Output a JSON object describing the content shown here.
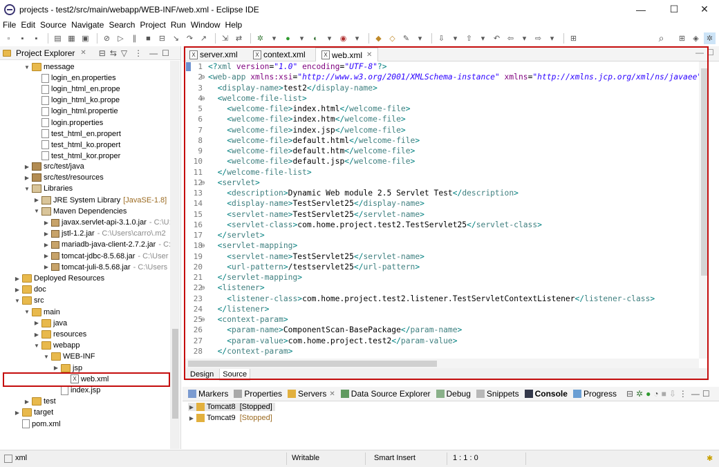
{
  "window": {
    "title": "projects - test2/src/main/webapp/WEB-INF/web.xml - Eclipse IDE",
    "minimize": "—",
    "maximize": "☐",
    "close": "✕"
  },
  "menu": [
    "File",
    "Edit",
    "Source",
    "Navigate",
    "Search",
    "Project",
    "Run",
    "Window",
    "Help"
  ],
  "explorer": {
    "title": "Project Explorer",
    "tree": [
      {
        "label": "message",
        "icon": "folder",
        "twist": "open",
        "level": 0
      },
      {
        "label": "login_en.properties",
        "icon": "file",
        "twist": "",
        "level": 1
      },
      {
        "label": "login_html_en.prope",
        "icon": "file",
        "twist": "",
        "level": 1
      },
      {
        "label": "login_html_ko.prope",
        "icon": "file",
        "twist": "",
        "level": 1
      },
      {
        "label": "login_html.propertie",
        "icon": "file",
        "twist": "",
        "level": 1
      },
      {
        "label": "login.properties",
        "icon": "file",
        "twist": "",
        "level": 1
      },
      {
        "label": "test_html_en.propert",
        "icon": "file",
        "twist": "",
        "level": 1
      },
      {
        "label": "test_html_ko.propert",
        "icon": "file",
        "twist": "",
        "level": 1
      },
      {
        "label": "test_html_kor.proper",
        "icon": "file",
        "twist": "",
        "level": 1
      }
    ],
    "tree2": [
      {
        "label": "src/test/java",
        "icon": "pkg",
        "twist": "closed",
        "level": 0
      },
      {
        "label": "src/test/resources",
        "icon": "pkg",
        "twist": "closed",
        "level": 0
      },
      {
        "label": "Libraries",
        "icon": "lib",
        "twist": "open",
        "level": 0
      },
      {
        "label": "JRE System Library",
        "extra": "[JavaSE-1.8]",
        "icon": "lib",
        "twist": "closed",
        "level": 1
      },
      {
        "label": "Maven Dependencies",
        "icon": "lib",
        "twist": "open",
        "level": 1
      },
      {
        "label": "javax.servlet-api-3.1.0.jar",
        "extra": "- C:\\U:",
        "icon": "jar",
        "twist": "closed",
        "level": 2
      },
      {
        "label": "jstl-1.2.jar",
        "extra": "- C:\\Users\\carro\\.m2",
        "icon": "jar",
        "twist": "closed",
        "level": 2
      },
      {
        "label": "mariadb-java-client-2.7.2.jar",
        "extra": "- C:",
        "icon": "jar",
        "twist": "closed",
        "level": 2
      },
      {
        "label": "tomcat-jdbc-8.5.68.jar",
        "extra": "- C:\\User",
        "icon": "jar",
        "twist": "closed",
        "level": 2
      },
      {
        "label": "tomcat-juli-8.5.68.jar",
        "extra": "- C:\\Users",
        "icon": "jar",
        "twist": "closed",
        "level": 2
      },
      {
        "label": "Deployed Resources",
        "icon": "folder",
        "twist": "closed",
        "level": -1
      },
      {
        "label": "doc",
        "icon": "folder",
        "twist": "closed",
        "level": -1
      },
      {
        "label": "src",
        "icon": "folder",
        "twist": "open",
        "level": -1
      },
      {
        "label": "main",
        "icon": "folder",
        "twist": "open",
        "level": 0
      },
      {
        "label": "java",
        "icon": "folder",
        "twist": "closed",
        "level": 1
      },
      {
        "label": "resources",
        "icon": "folder",
        "twist": "closed",
        "level": 1
      },
      {
        "label": "webapp",
        "icon": "folder",
        "twist": "open",
        "level": 1
      },
      {
        "label": "WEB-INF",
        "icon": "folder",
        "twist": "open",
        "level": 2
      },
      {
        "label": "jsp",
        "icon": "folder",
        "twist": "closed",
        "level": 3
      },
      {
        "label": "web.xml",
        "icon": "xml",
        "twist": "",
        "level": 4
      },
      {
        "label": "index.jsp",
        "icon": "file",
        "twist": "",
        "level": 3
      },
      {
        "label": "test",
        "icon": "folder",
        "twist": "closed",
        "level": 0
      },
      {
        "label": "target",
        "icon": "folder",
        "twist": "closed",
        "level": -1
      },
      {
        "label": "pom.xml",
        "icon": "file",
        "twist": "",
        "level": -1
      }
    ]
  },
  "editor": {
    "tabs": [
      "server.xml",
      "context.xml",
      "web.xml"
    ],
    "active_tab": "web.xml",
    "bottom_tabs": [
      "Design",
      "Source"
    ],
    "lines": [
      {
        "n": "1",
        "fold": false,
        "html": "<span class=\"p\">&lt;?</span><span class=\"t\">xml</span> <span class=\"a\">version</span>=<span class=\"v\">\"1.0\"</span> <span class=\"a\">encoding</span>=<span class=\"v\">\"UTF-8\"</span><span class=\"p\">?&gt;</span>"
      },
      {
        "n": "2",
        "fold": true,
        "html": "<span class=\"p\">&lt;</span><span class=\"t\">web-app</span> <span class=\"a\">xmlns:xsi</span>=<span class=\"v\">\"http://www.w3.org/2001/XMLSchema-instance\"</span> <span class=\"a\">xmlns</span>=<span class=\"v\">\"http://xmlns.jcp.org/xml/ns/javaee\"</span>"
      },
      {
        "n": "3",
        "fold": false,
        "html": "  <span class=\"p\">&lt;</span><span class=\"t\">display-name</span><span class=\"p\">&gt;</span>test2<span class=\"p\">&lt;/</span><span class=\"t\">display-name</span><span class=\"p\">&gt;</span>"
      },
      {
        "n": "4",
        "fold": true,
        "html": "  <span class=\"p\">&lt;</span><span class=\"t\">welcome-file-list</span><span class=\"p\">&gt;</span>"
      },
      {
        "n": "5",
        "fold": false,
        "html": "    <span class=\"p\">&lt;</span><span class=\"t\">welcome-file</span><span class=\"p\">&gt;</span>index.html<span class=\"p\">&lt;/</span><span class=\"t\">welcome-file</span><span class=\"p\">&gt;</span>"
      },
      {
        "n": "6",
        "fold": false,
        "html": "    <span class=\"p\">&lt;</span><span class=\"t\">welcome-file</span><span class=\"p\">&gt;</span>index.htm<span class=\"p\">&lt;/</span><span class=\"t\">welcome-file</span><span class=\"p\">&gt;</span>"
      },
      {
        "n": "7",
        "fold": false,
        "html": "    <span class=\"p\">&lt;</span><span class=\"t\">welcome-file</span><span class=\"p\">&gt;</span>index.jsp<span class=\"p\">&lt;/</span><span class=\"t\">welcome-file</span><span class=\"p\">&gt;</span>"
      },
      {
        "n": "8",
        "fold": false,
        "html": "    <span class=\"p\">&lt;</span><span class=\"t\">welcome-file</span><span class=\"p\">&gt;</span>default.html<span class=\"p\">&lt;/</span><span class=\"t\">welcome-file</span><span class=\"p\">&gt;</span>"
      },
      {
        "n": "9",
        "fold": false,
        "html": "    <span class=\"p\">&lt;</span><span class=\"t\">welcome-file</span><span class=\"p\">&gt;</span>default.htm<span class=\"p\">&lt;/</span><span class=\"t\">welcome-file</span><span class=\"p\">&gt;</span>"
      },
      {
        "n": "10",
        "fold": false,
        "html": "    <span class=\"p\">&lt;</span><span class=\"t\">welcome-file</span><span class=\"p\">&gt;</span>default.jsp<span class=\"p\">&lt;/</span><span class=\"t\">welcome-file</span><span class=\"p\">&gt;</span>"
      },
      {
        "n": "11",
        "fold": false,
        "html": "  <span class=\"p\">&lt;/</span><span class=\"t\">welcome-file-list</span><span class=\"p\">&gt;</span>"
      },
      {
        "n": "12",
        "fold": true,
        "html": "  <span class=\"p\">&lt;</span><span class=\"t\">servlet</span><span class=\"p\">&gt;</span>"
      },
      {
        "n": "13",
        "fold": false,
        "html": "    <span class=\"p\">&lt;</span><span class=\"t\">description</span><span class=\"p\">&gt;</span>Dynamic Web module 2.5 Servlet Test<span class=\"p\">&lt;/</span><span class=\"t\">description</span><span class=\"p\">&gt;</span>"
      },
      {
        "n": "14",
        "fold": false,
        "html": "    <span class=\"p\">&lt;</span><span class=\"t\">display-name</span><span class=\"p\">&gt;</span>TestServlet25<span class=\"p\">&lt;/</span><span class=\"t\">display-name</span><span class=\"p\">&gt;</span>"
      },
      {
        "n": "15",
        "fold": false,
        "html": "    <span class=\"p\">&lt;</span><span class=\"t\">servlet-name</span><span class=\"p\">&gt;</span>TestServlet25<span class=\"p\">&lt;/</span><span class=\"t\">servlet-name</span><span class=\"p\">&gt;</span>"
      },
      {
        "n": "16",
        "fold": false,
        "html": "    <span class=\"p\">&lt;</span><span class=\"t\">servlet-class</span><span class=\"p\">&gt;</span>com.home.project.test2.TestServlet25<span class=\"p\">&lt;/</span><span class=\"t\">servlet-class</span><span class=\"p\">&gt;</span>"
      },
      {
        "n": "17",
        "fold": false,
        "html": "  <span class=\"p\">&lt;/</span><span class=\"t\">servlet</span><span class=\"p\">&gt;</span>"
      },
      {
        "n": "18",
        "fold": true,
        "html": "  <span class=\"p\">&lt;</span><span class=\"t\">servlet-mapping</span><span class=\"p\">&gt;</span>"
      },
      {
        "n": "19",
        "fold": false,
        "html": "    <span class=\"p\">&lt;</span><span class=\"t\">servlet-name</span><span class=\"p\">&gt;</span>TestServlet25<span class=\"p\">&lt;/</span><span class=\"t\">servlet-name</span><span class=\"p\">&gt;</span>"
      },
      {
        "n": "20",
        "fold": false,
        "html": "    <span class=\"p\">&lt;</span><span class=\"t\">url-pattern</span><span class=\"p\">&gt;</span>/testservlet25<span class=\"p\">&lt;/</span><span class=\"t\">url-pattern</span><span class=\"p\">&gt;</span>"
      },
      {
        "n": "21",
        "fold": false,
        "html": "  <span class=\"p\">&lt;/</span><span class=\"t\">servlet-mapping</span><span class=\"p\">&gt;</span>"
      },
      {
        "n": "22",
        "fold": true,
        "html": "  <span class=\"p\">&lt;</span><span class=\"t\">listener</span><span class=\"p\">&gt;</span>"
      },
      {
        "n": "23",
        "fold": false,
        "html": "    <span class=\"p\">&lt;</span><span class=\"t\">listener-class</span><span class=\"p\">&gt;</span>com.home.project.test2.listener.TestServletContextListener<span class=\"p\">&lt;/</span><span class=\"t\">listener-class</span><span class=\"p\">&gt;</span>"
      },
      {
        "n": "24",
        "fold": false,
        "html": "  <span class=\"p\">&lt;/</span><span class=\"t\">listener</span><span class=\"p\">&gt;</span>"
      },
      {
        "n": "25",
        "fold": true,
        "html": "  <span class=\"p\">&lt;</span><span class=\"t\">context-param</span><span class=\"p\">&gt;</span>"
      },
      {
        "n": "26",
        "fold": false,
        "html": "    <span class=\"p\">&lt;</span><span class=\"t\">param-name</span><span class=\"p\">&gt;</span>ComponentScan-BasePackage<span class=\"p\">&lt;/</span><span class=\"t\">param-name</span><span class=\"p\">&gt;</span>"
      },
      {
        "n": "27",
        "fold": false,
        "html": "    <span class=\"p\">&lt;</span><span class=\"t\">param-value</span><span class=\"p\">&gt;</span>com.home.project.test2<span class=\"p\">&lt;/</span><span class=\"t\">param-value</span><span class=\"p\">&gt;</span>"
      },
      {
        "n": "28",
        "fold": false,
        "html": "  <span class=\"p\">&lt;/</span><span class=\"t\">context-param</span><span class=\"p\">&gt;</span>"
      }
    ]
  },
  "bottom": {
    "tabs": [
      "Markers",
      "Properties",
      "Servers",
      "Data Source Explorer",
      "Debug",
      "Snippets",
      "Console",
      "Progress"
    ],
    "active": "Servers",
    "servers": [
      {
        "name": "Tomcat8",
        "state": "[Stopped]"
      },
      {
        "name": "Tomcat9",
        "state": "[Stopped]"
      }
    ]
  },
  "status": {
    "file": "xml",
    "writable": "Writable",
    "insert": "Smart Insert",
    "pos": "1 : 1 : 0"
  },
  "colors": {
    "annotation_red": "#c40c0c",
    "xml_tag": "#3f7f7f",
    "xml_attr": "#7f007f",
    "xml_value": "#2a00ff"
  }
}
